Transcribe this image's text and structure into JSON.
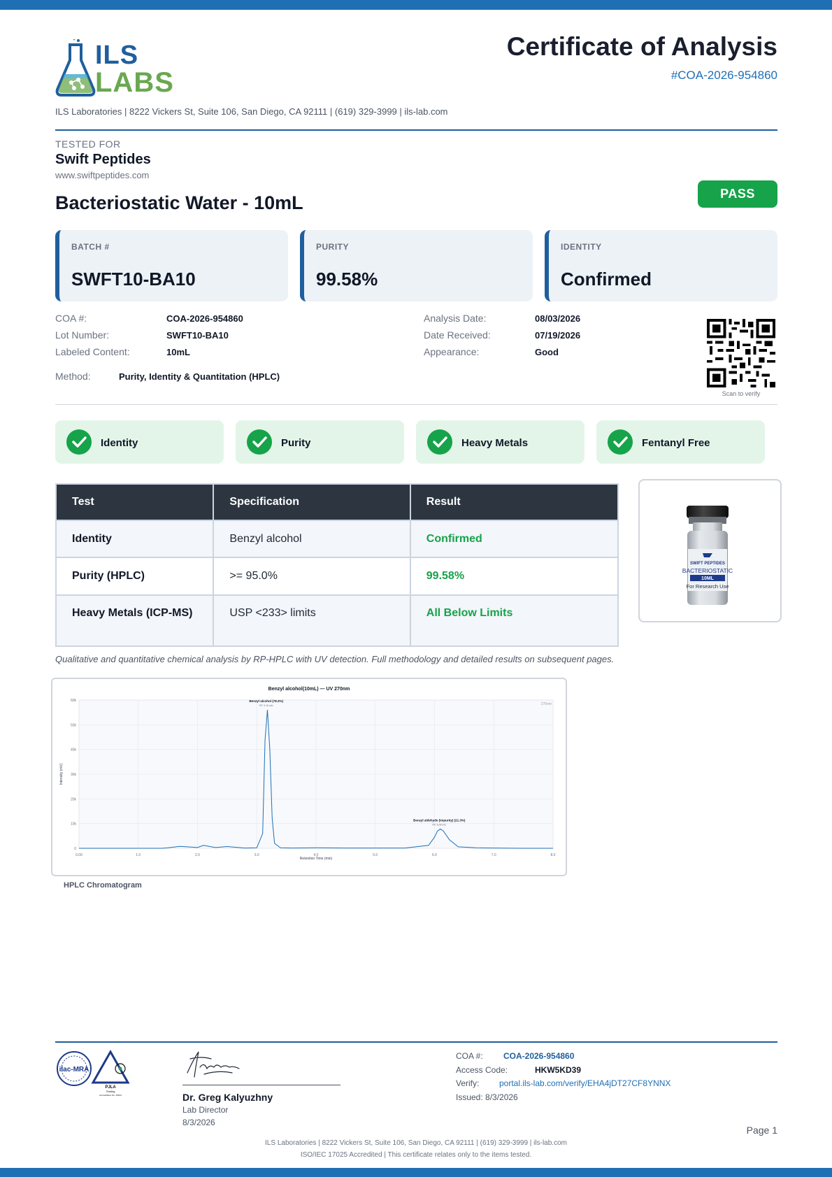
{
  "header": {
    "logo_line1": "ILS",
    "logo_line2": "LABS",
    "address": "ILS Laboratories  |  8222 Vickers St, Suite 106, San Diego, CA 92111  |  (619) 329-3999  |  ils-lab.com",
    "title": "Certificate of Analysis",
    "cert_number": "#COA-2026-954860"
  },
  "client": {
    "tested_for_label": "TESTED FOR",
    "name": "Swift Peptides",
    "url": "www.swiftpeptides.com"
  },
  "product": {
    "name": "Bacteriostatic Water - 10mL",
    "status": "PASS"
  },
  "summary_cards": [
    {
      "label": "BATCH #",
      "value": "SWFT10-BA10"
    },
    {
      "label": "PURITY",
      "value": "99.58%"
    },
    {
      "label": "IDENTITY",
      "value": "Confirmed"
    }
  ],
  "details": {
    "coa_label": "COA #:",
    "coa_value": "COA-2026-954860",
    "lot_label": "Lot Number:",
    "lot_value": "SWFT10-BA10",
    "content_label": "Labeled Content:",
    "content_value": "10mL",
    "method_label": "Method:",
    "method_value": "Purity, Identity & Quantitation (HPLC)",
    "analysis_label": "Analysis Date:",
    "analysis_value": "08/03/2026",
    "received_label": "Date Received:",
    "received_value": "07/19/2026",
    "appearance_label": "Appearance:",
    "appearance_value": "Good",
    "qr_caption": "Scan to verify"
  },
  "checks": [
    "Identity",
    "Purity",
    "Heavy Metals",
    "Fentanyl Free"
  ],
  "table": {
    "headers": [
      "Test",
      "Specification",
      "Result"
    ],
    "rows": [
      {
        "test": "Identity",
        "spec": "Benzyl alcohol",
        "result": "Confirmed"
      },
      {
        "test": "Purity (HPLC)",
        "spec": ">= 95.0%",
        "result": "99.58%"
      },
      {
        "test": "Heavy Metals (ICP-MS)",
        "spec": "USP <233> limits",
        "result": "All Below Limits"
      }
    ]
  },
  "vial": {
    "brand": "SWIFT PEPTIDES",
    "name": "BACTERIOSTATIC",
    "volume": "10ML",
    "note": "For Research Use"
  },
  "note": "Qualitative and quantitative chemical analysis by RP-HPLC with UV detection. Full methodology and detailed results on subsequent pages.",
  "chart_data": {
    "type": "line",
    "title": "Benzyl alcohol(10mL) — UV 270nm",
    "xlabel": "Retention Time (min)",
    "ylabel": "Intensity (mV)",
    "xlim": [
      0,
      8
    ],
    "ylim": [
      0,
      60000
    ],
    "x_ticks": [
      "0.00",
      "1.0",
      "2.0",
      "3.0",
      "4.0",
      "5.0",
      "6.0",
      "7.0",
      "8.0"
    ],
    "y_ticks": [
      "0",
      "10k",
      "20k",
      "30k",
      "40k",
      "50k",
      "60k"
    ],
    "corner_label": "270nm",
    "grid": true,
    "series": [
      {
        "x": [
          0,
          0.5,
          1.0,
          1.2,
          1.4,
          1.5,
          1.7,
          1.9,
          2.0,
          2.1,
          2.3,
          2.5,
          2.8,
          3.0,
          3.1,
          3.14,
          3.18,
          3.22,
          3.26,
          3.3,
          3.4,
          3.6,
          4.0,
          4.5,
          5.0,
          5.5,
          5.9,
          6.0,
          6.05,
          6.1,
          6.15,
          6.25,
          6.4,
          6.7,
          7.0,
          7.5,
          8.0
        ],
        "y": [
          0,
          0,
          0,
          0,
          0,
          200,
          800,
          500,
          300,
          1200,
          300,
          700,
          100,
          200,
          6000,
          44000,
          56000,
          40000,
          12000,
          2000,
          200,
          100,
          200,
          100,
          100,
          100,
          1200,
          4500,
          7000,
          7800,
          7000,
          3500,
          600,
          200,
          100,
          0,
          0
        ]
      }
    ],
    "annotations": [
      {
        "label": "Benzyl alcohol (78.2%)",
        "sub": "RT: 3.16 min",
        "x": 3.16,
        "y": 56000
      },
      {
        "label": "Benzyl aldehyde (impurity) (21.3%)",
        "sub": "RT: 6.08 min",
        "x": 6.08,
        "y": 7800
      }
    ],
    "caption": "HPLC Chromatogram"
  },
  "footer": {
    "signer": "Dr. Greg Kalyuzhny",
    "signer_title": "Lab Director",
    "signer_date": "8/3/2026",
    "coa_label": "COA #:",
    "coa_value": "COA-2026-954860",
    "access_label": "Access Code:",
    "access_value": "HKW5KD39",
    "verify_label": "Verify:",
    "verify_value": "portal.ils-lab.com/verify/EHA4jDT27CF8YNNX",
    "issued": "Issued: 8/3/2026",
    "page": "Page 1",
    "line1": "ILS Laboratories  |  8222 Vickers St, Suite 106, San Diego, CA 92111  |  (619) 329-3999  |  ils-lab.com",
    "line2": "ISO/IEC 17025 Accredited  |  This certificate relates only to the items tested.",
    "ilac_text": "ilac-MRA",
    "pjla_text": "PJLA",
    "pjla_sub": "Testing",
    "pjla_acc": "Accreditation No. 29612",
    "colors": {
      "primary": "#1f5f9e",
      "accent": "#1f6fb5",
      "pass": "#16a34a",
      "logo_green": "#6aa84f"
    }
  }
}
